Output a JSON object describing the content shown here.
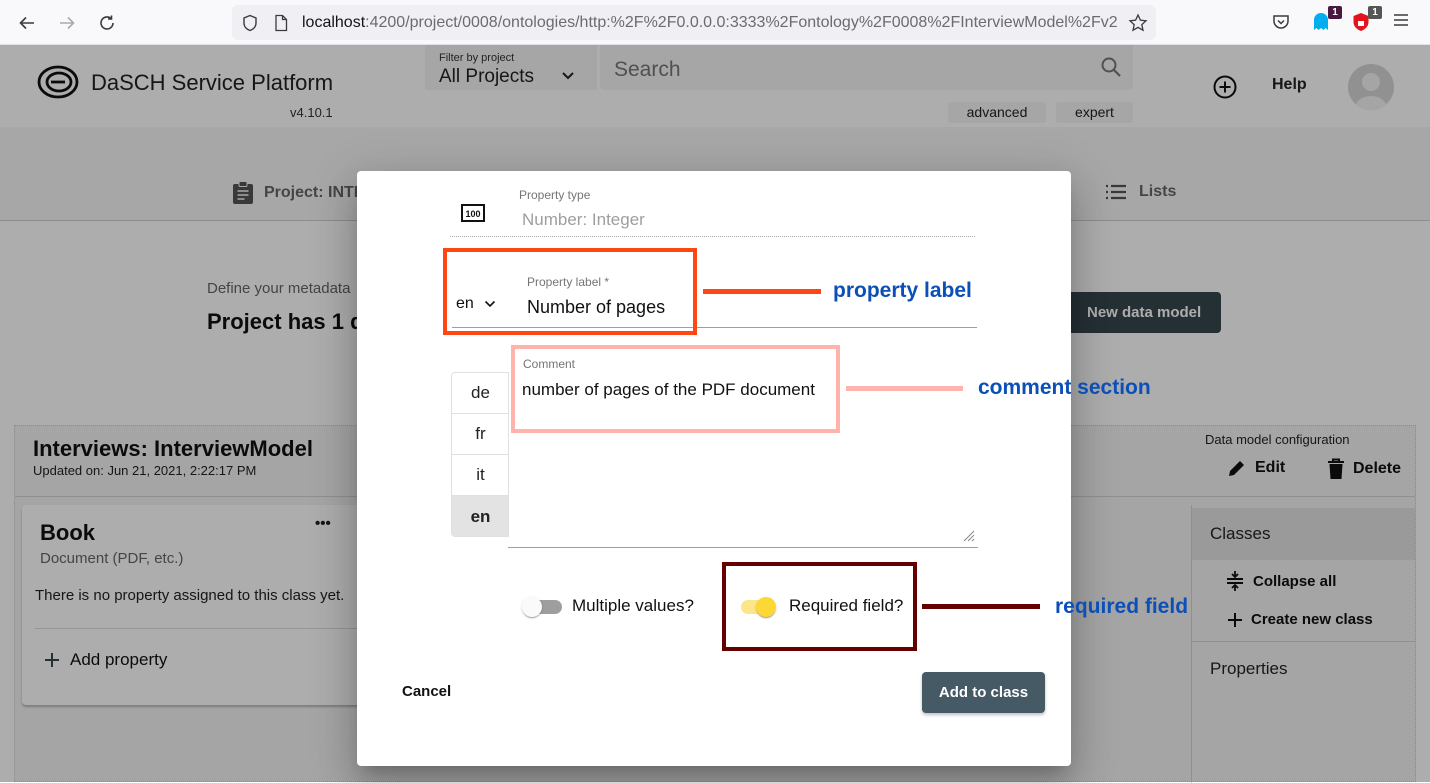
{
  "browser": {
    "url_host": "localhost",
    "url_rest": ":4200/project/0008/ontologies/http:%2F%2F0.0.0.0:3333%2Fontology%2F0008%2FInterviewModel%2Fv2",
    "extensions": [
      {
        "name": "pocket",
        "badge": ""
      },
      {
        "name": "ghostery",
        "badge": "1"
      },
      {
        "name": "ublock",
        "badge": "1"
      }
    ]
  },
  "header": {
    "app_title": "DaSCH Service Platform",
    "version": "v4.10.1",
    "filter_label": "Filter by project",
    "filter_value": "All Projects",
    "search_placeholder": "Search",
    "search_advanced": "advanced",
    "search_expert": "expert",
    "help": "Help"
  },
  "project_nav": {
    "project_tab": "Project: INTE",
    "lists_tab": "Lists"
  },
  "project_page": {
    "define_text": "Define your metadata",
    "models_count_text": "Project has 1 d",
    "new_data_model_button": "New data model"
  },
  "ontology": {
    "title": "Interviews: InterviewModel",
    "updated": "Updated on: Jun 21, 2021, 2:22:17 PM",
    "config_label": "Data model configuration",
    "edit": "Edit",
    "delete": "Delete"
  },
  "class_card": {
    "title": "Book",
    "subtitle": "Document (PDF, etc.)",
    "empty_text": "There is no property assigned to this class yet.",
    "add_property": "Add property",
    "more_menu": "•••"
  },
  "sidebar": {
    "classes_header": "Classes",
    "collapse_all": "Collapse all",
    "create_new_class": "Create new class",
    "properties_header": "Properties"
  },
  "dialog": {
    "property_type_label": "Property type",
    "property_type_value": "Number: Integer",
    "property_label_label": "Property label *",
    "property_label_value": "Number of pages",
    "property_label_lang": "en",
    "comment_label": "Comment",
    "comment_value": "number of pages of the PDF document",
    "comment_languages": [
      {
        "code": "de",
        "active": false
      },
      {
        "code": "fr",
        "active": false
      },
      {
        "code": "it",
        "active": false
      },
      {
        "code": "en",
        "active": true
      }
    ],
    "multiple_values_label": "Multiple values?",
    "multiple_values_on": false,
    "required_field_label": "Required field?",
    "required_field_on": true,
    "cancel": "Cancel",
    "submit": "Add to class"
  },
  "annotations": {
    "property_label": "property label",
    "comment_section": "comment section",
    "required_field": "required field",
    "colors": {
      "property_label": "#ff4713",
      "comment_section": "#ffb3ad",
      "required_field": "#650000",
      "text": "#0b4fb7"
    }
  }
}
